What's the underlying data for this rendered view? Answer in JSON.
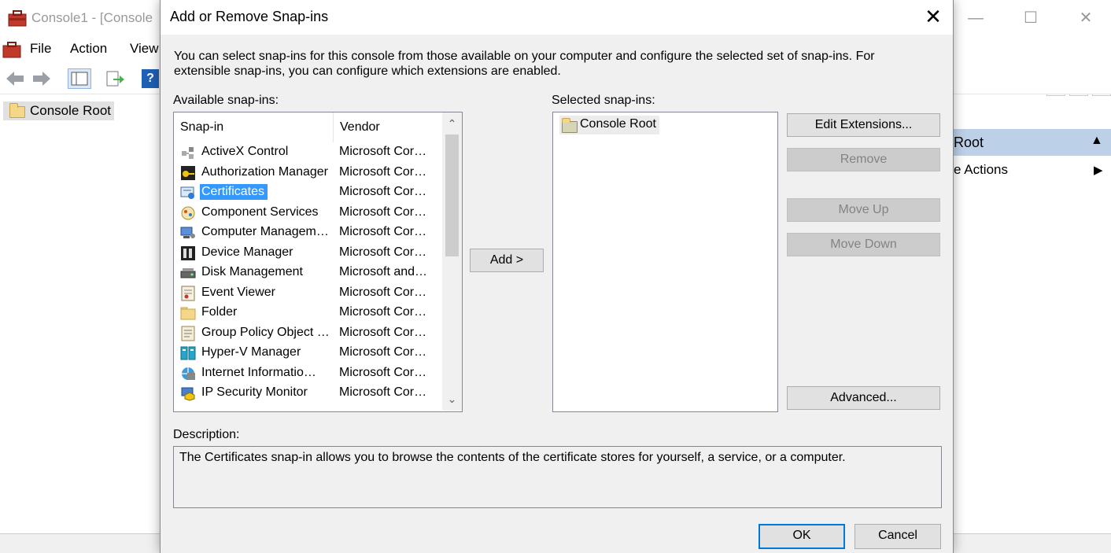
{
  "background_window": {
    "title": "Console1 - [Console",
    "menu": [
      "File",
      "Action",
      "View"
    ],
    "tree_root": "Console Root",
    "actions_header": "Root",
    "actions_sub": "e Actions"
  },
  "dialog": {
    "title": "Add or Remove Snap-ins",
    "intro": "You can select snap-ins for this console from those available on your computer and configure the selected set of snap-ins. For extensible snap-ins, you can configure which extensions are enabled.",
    "available_label": "Available snap-ins:",
    "columns": {
      "snapin": "Snap-in",
      "vendor": "Vendor"
    },
    "snapins": [
      {
        "name": "ActiveX Control",
        "vendor": "Microsoft Cor…",
        "icon": "activex-icon"
      },
      {
        "name": "Authorization Manager",
        "vendor": "Microsoft Cor…",
        "icon": "authorization-icon"
      },
      {
        "name": "Certificates",
        "vendor": "Microsoft Cor…",
        "icon": "certificates-icon",
        "selected": true
      },
      {
        "name": "Component Services",
        "vendor": "Microsoft Cor…",
        "icon": "component-services-icon"
      },
      {
        "name": "Computer Managem…",
        "vendor": "Microsoft Cor…",
        "icon": "computer-management-icon"
      },
      {
        "name": "Device Manager",
        "vendor": "Microsoft Cor…",
        "icon": "device-manager-icon"
      },
      {
        "name": "Disk Management",
        "vendor": "Microsoft and…",
        "icon": "disk-management-icon"
      },
      {
        "name": "Event Viewer",
        "vendor": "Microsoft Cor…",
        "icon": "event-viewer-icon"
      },
      {
        "name": "Folder",
        "vendor": "Microsoft Cor…",
        "icon": "folder-icon"
      },
      {
        "name": "Group Policy Object …",
        "vendor": "Microsoft Cor…",
        "icon": "group-policy-icon"
      },
      {
        "name": "Hyper-V Manager",
        "vendor": "Microsoft Cor…",
        "icon": "hyper-v-icon"
      },
      {
        "name": "Internet Informatio…",
        "vendor": "Microsoft Cor…",
        "icon": "iis-icon"
      },
      {
        "name": "IP Security Monitor",
        "vendor": "Microsoft Cor…",
        "icon": "ip-security-icon"
      }
    ],
    "add_button": "Add >",
    "selected_label": "Selected snap-ins:",
    "selected_items": [
      "Console Root"
    ],
    "buttons": {
      "edit_extensions": "Edit Extensions...",
      "remove": "Remove",
      "move_up": "Move Up",
      "move_down": "Move Down",
      "advanced": "Advanced...",
      "ok": "OK",
      "cancel": "Cancel"
    },
    "description_label": "Description:",
    "description": "The Certificates snap-in allows you to browse the contents of the certificate stores for yourself, a service, or a computer."
  },
  "colors": {
    "selection": "#3399ff",
    "accent": "#0078d7",
    "dialog_bg": "#f0f0f0",
    "actions_header_bg": "#bcd0e8"
  }
}
